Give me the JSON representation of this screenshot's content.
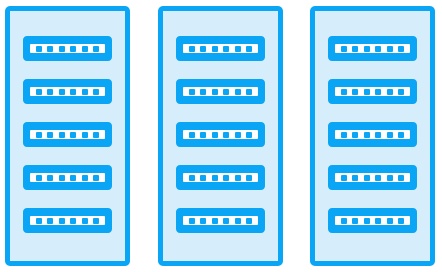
{
  "racks": [
    {
      "slots": 5,
      "ports_per_slot": 6
    },
    {
      "slots": 5,
      "ports_per_slot": 6
    },
    {
      "slots": 5,
      "ports_per_slot": 6
    }
  ],
  "colors": {
    "frame": "#0aa6f5",
    "panel": "#d6eefc",
    "face": "#ffffff"
  },
  "icon": "server-racks-icon"
}
